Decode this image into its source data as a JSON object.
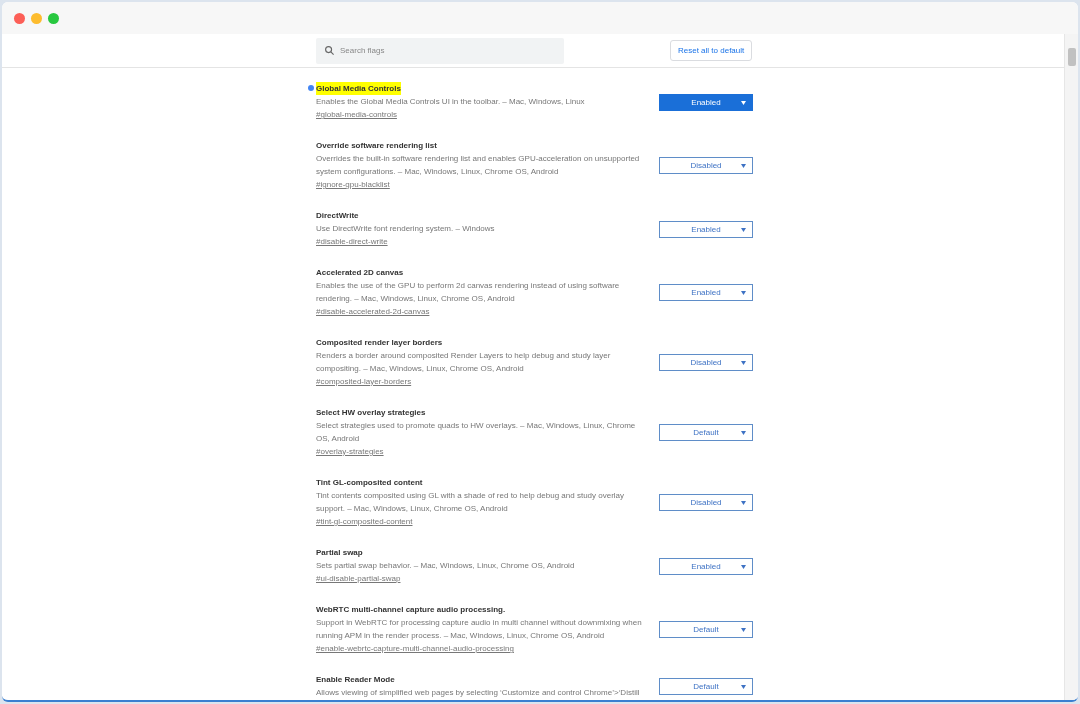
{
  "search": {
    "placeholder": "Search flags"
  },
  "reset_button": "Reset all to default",
  "flags": [
    {
      "title": "Global Media Controls",
      "description": "Enables the Global Media Controls UI in the toolbar. – Mac, Windows, Linux",
      "link": "#global-media-controls",
      "value": "Enabled",
      "modified": true,
      "highlighted": true
    },
    {
      "title": "Override software rendering list",
      "description": "Overrides the built-in software rendering list and enables GPU-acceleration on unsupported system configurations. – Mac, Windows, Linux, Chrome OS, Android",
      "link": "#ignore-gpu-blacklist",
      "value": "Disabled",
      "modified": false,
      "highlighted": false
    },
    {
      "title": "DirectWrite",
      "description": "Use DirectWrite font rendering system. – Windows",
      "link": "#disable-direct-write",
      "value": "Enabled",
      "modified": false,
      "highlighted": false
    },
    {
      "title": "Accelerated 2D canvas",
      "description": "Enables the use of the GPU to perform 2d canvas rendering instead of using software rendering. – Mac, Windows, Linux, Chrome OS, Android",
      "link": "#disable-accelerated-2d-canvas",
      "value": "Enabled",
      "modified": false,
      "highlighted": false
    },
    {
      "title": "Composited render layer borders",
      "description": "Renders a border around composited Render Layers to help debug and study layer compositing. – Mac, Windows, Linux, Chrome OS, Android",
      "link": "#composited-layer-borders",
      "value": "Disabled",
      "modified": false,
      "highlighted": false
    },
    {
      "title": "Select HW overlay strategies",
      "description": "Select strategies used to promote quads to HW overlays. – Mac, Windows, Linux, Chrome OS, Android",
      "link": "#overlay-strategies",
      "value": "Default",
      "modified": false,
      "highlighted": false
    },
    {
      "title": "Tint GL-composited content",
      "description": "Tint contents composited using GL with a shade of red to help debug and study overlay support. – Mac, Windows, Linux, Chrome OS, Android",
      "link": "#tint-gl-composited-content",
      "value": "Disabled",
      "modified": false,
      "highlighted": false
    },
    {
      "title": "Partial swap",
      "description": "Sets partial swap behavior. – Mac, Windows, Linux, Chrome OS, Android",
      "link": "#ui-disable-partial-swap",
      "value": "Enabled",
      "modified": false,
      "highlighted": false
    },
    {
      "title": "WebRTC multi-channel capture audio processing.",
      "description": "Support in WebRTC for processing capture audio in multi channel without downmixing when running APM in the render process. – Mac, Windows, Linux, Chrome OS, Android",
      "link": "#enable-webrtc-capture-multi-channel-audio-processing",
      "value": "Default",
      "modified": false,
      "highlighted": false
    },
    {
      "title": "Enable Reader Mode",
      "description": "Allows viewing of simplified web pages by selecting ‘Customize and control Chrome’>‘Distill",
      "value": "Default",
      "modified": false,
      "highlighted": false
    }
  ]
}
